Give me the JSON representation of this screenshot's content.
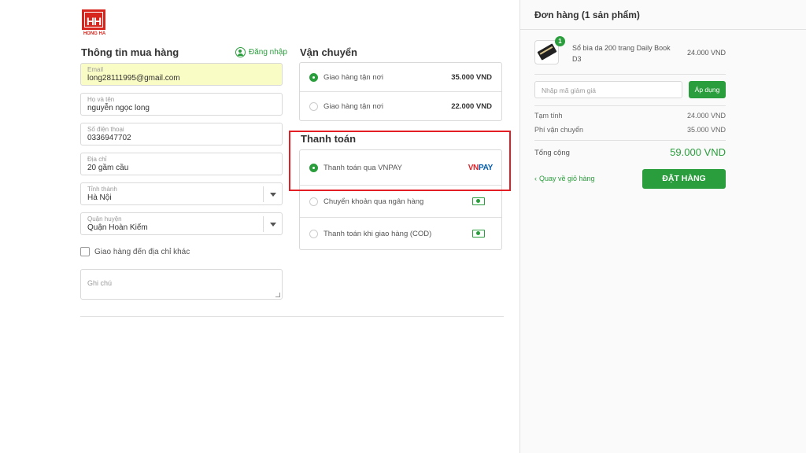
{
  "brand": {
    "logo_mark": "HH",
    "logo_text": "HONG HA"
  },
  "customer": {
    "title": "Thông tin mua hàng",
    "login_label": "Đăng nhập",
    "fields": [
      {
        "label": "Email",
        "value": "long28111995@gmail.com"
      },
      {
        "label": "Họ và tên",
        "value": "nguyễn ngọc long"
      },
      {
        "label": "Số điện thoại",
        "value": "0336947702"
      },
      {
        "label": "Địa chỉ",
        "value": "20 gầm cầu"
      },
      {
        "label": "Tỉnh thành",
        "value": "Hà Nội"
      },
      {
        "label": "Quận huyện",
        "value": "Quận Hoàn Kiếm"
      }
    ],
    "ship_other_label": "Giao hàng đến địa chỉ khác",
    "note_placeholder": "Ghi chú"
  },
  "shipping": {
    "title": "Vận chuyển",
    "options": [
      {
        "label": "Giao hàng tận nơi",
        "price": "35.000 VND",
        "selected": true
      },
      {
        "label": "Giao hàng tận nơi",
        "price": "22.000 VND",
        "selected": false
      }
    ]
  },
  "payment": {
    "title": "Thanh toán",
    "options": [
      {
        "label": "Thanh toán qua VNPAY",
        "logo_vn": "VN",
        "logo_pay": "PAY",
        "selected": true
      },
      {
        "label": "Chuyển khoản qua ngân hàng",
        "icon": "cash-icon",
        "selected": false
      },
      {
        "label": "Thanh toán khi giao hàng (COD)",
        "icon": "cash-icon",
        "selected": false
      }
    ]
  },
  "order": {
    "title": "Đơn hàng (1 sản phẩm)",
    "item": {
      "qty": "1",
      "name": "Sổ bìa da 200 trang Daily Book D3",
      "price": "24.000 VND"
    },
    "coupon_placeholder": "Nhập mã giảm giá",
    "apply_label": "Áp dụng",
    "subtotal_label": "Tạm tính",
    "subtotal_value": "24.000 VND",
    "shipping_label": "Phí vận chuyển",
    "shipping_value": "35.000 VND",
    "total_label": "Tổng cộng",
    "total_value": "59.000 VND",
    "back_label": "Quay về giỏ hàng",
    "submit_label": "ĐẶT HÀNG"
  },
  "colors": {
    "accent": "#2a9d3c",
    "highlight": "#e31e24",
    "autofill": "#fafcc5"
  }
}
